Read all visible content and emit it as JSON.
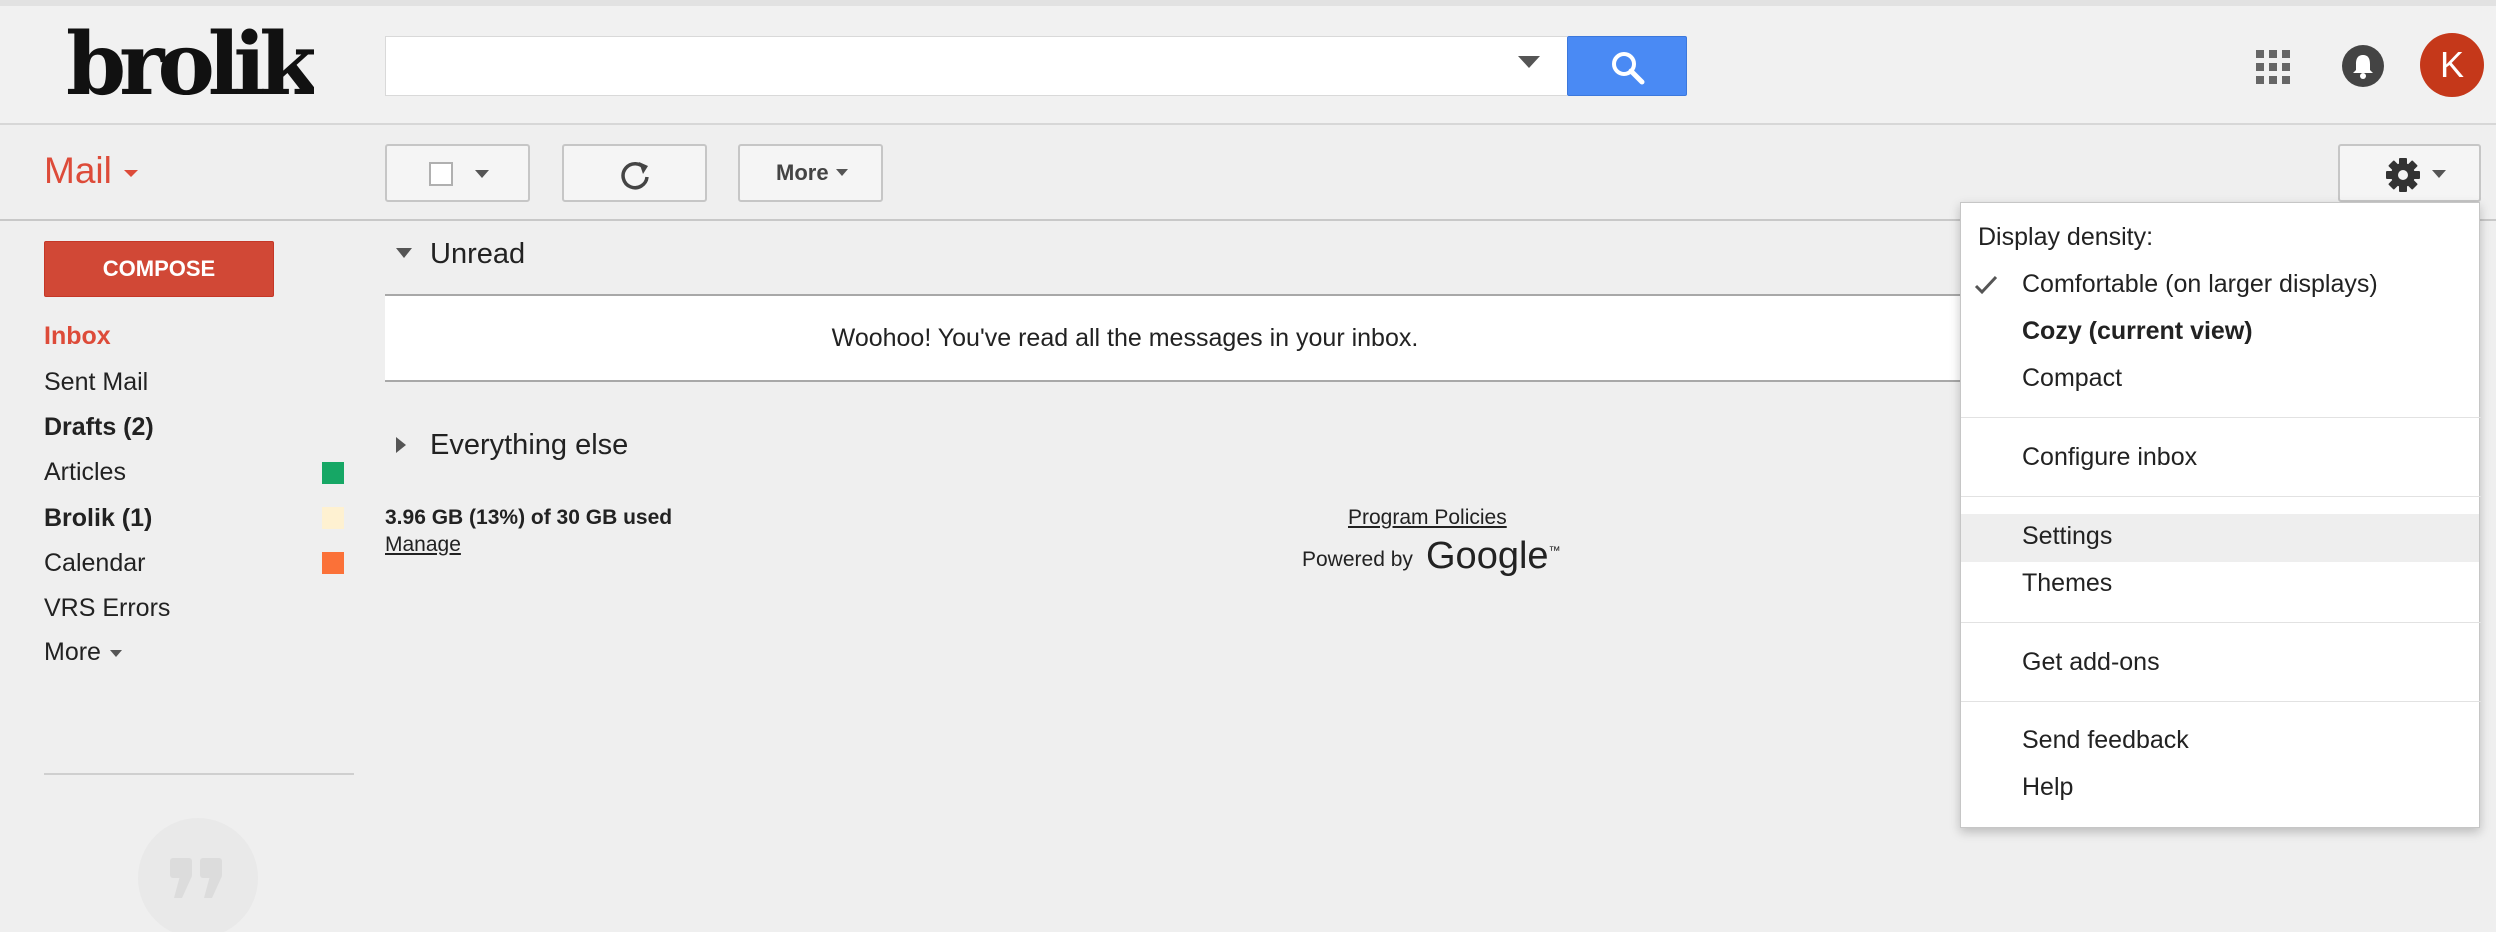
{
  "header": {
    "logo_text": "brolik",
    "search_value": "",
    "avatar_letter": "K",
    "icons": [
      "search-icon",
      "apps-grid-icon",
      "notifications-bell-icon"
    ]
  },
  "toolbar": {
    "app_label": "Mail",
    "more_label": "More"
  },
  "nav": {
    "compose_label": "COMPOSE",
    "items": [
      {
        "label": "Inbox",
        "color": "#dd4b39",
        "bold": true
      },
      {
        "label": "Sent Mail"
      },
      {
        "label": "Drafts (2)",
        "bold": true
      },
      {
        "label": "Articles",
        "label_color": "#16a765"
      },
      {
        "label": "Brolik (1)",
        "bold": true,
        "label_color": "#fef1d1"
      },
      {
        "label": "Calendar",
        "label_color": "#fb7138"
      },
      {
        "label": "VRS Errors"
      },
      {
        "label": "More"
      }
    ]
  },
  "main": {
    "sections": [
      {
        "label": "Unread",
        "expanded": true,
        "empty_message": "Woohoo! You've read all the messages in your inbox."
      },
      {
        "label": "Everything else",
        "expanded": false
      }
    ],
    "footer": {
      "storage": "3.96 GB (13%) of 30 GB used",
      "manage": "Manage",
      "policies": "Program Policies",
      "powered_by": "Powered by",
      "google": "Google",
      "tm": "™"
    }
  },
  "settings_menu": {
    "density_heading": "Display density:",
    "density_options": [
      {
        "label": "Comfortable (on larger displays)",
        "checked": true
      },
      {
        "label": "Cozy (current view)",
        "bold": true
      },
      {
        "label": "Compact"
      }
    ],
    "configure_inbox": "Configure inbox",
    "settings": "Settings",
    "themes": "Themes",
    "get_addons": "Get add-ons",
    "send_feedback": "Send feedback",
    "help": "Help"
  }
}
